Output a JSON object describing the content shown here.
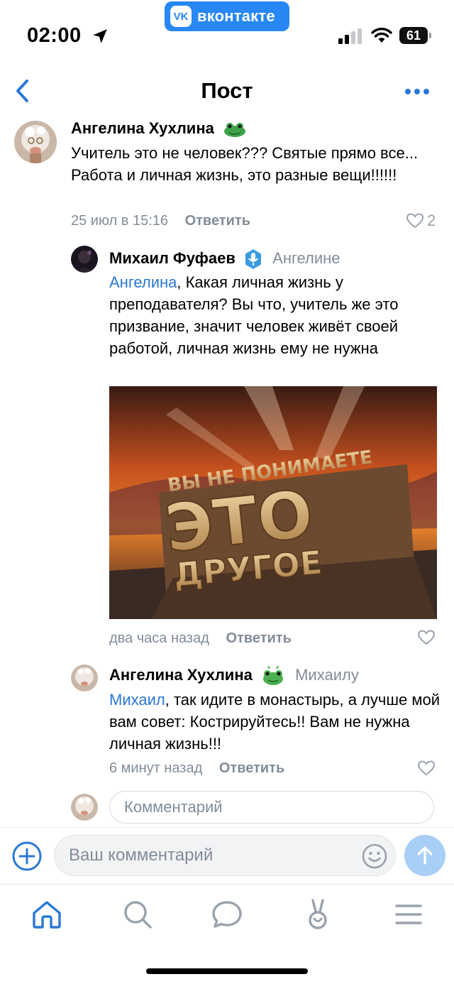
{
  "status_bar": {
    "time": "02:00",
    "app_badge": "вконтакте",
    "app_badge_logo": "VK",
    "battery": "61"
  },
  "nav": {
    "title": "Пост"
  },
  "comments": [
    {
      "author": "Ангелина Хухлина",
      "text": "Учитель это не человек??? Святые прямо все... Работа и личная жизнь, это разные вещи!!!!!!",
      "time": "25 июл в 15:16",
      "reply_label": "Ответить",
      "likes": "2"
    },
    {
      "author": "Михаил Фуфаев",
      "reply_to": "Ангелине",
      "mention": "Ангелина",
      "text": ", Какая личная жизнь у преподавателя? Вы что, учитель же это призвание, значит человек живёт своей работой, личная жизнь ему не нужна",
      "image_text_top": "ВЫ НЕ ПОНИМАЕТЕ",
      "image_text_main": "ЭТО",
      "image_text_bottom": "ДРУГОЕ",
      "time": "два часа назад",
      "reply_label": "Ответить"
    },
    {
      "author": "Ангелина Хухлина",
      "reply_to": "Михаилу",
      "mention": "Михаил",
      "text": ", так идите в монастырь, а лучше мой вам совет: Кострируйтесь!! Вам не нужна личная жизнь!!!",
      "time": "6 минут назад",
      "reply_label": "Ответить"
    }
  ],
  "comment_input": {
    "placeholder": "Комментарий"
  },
  "composer": {
    "placeholder": "Ваш комментарий"
  },
  "tabbar": {
    "icons": [
      "home-icon",
      "search-icon",
      "messages-icon",
      "clips-icon",
      "menu-icon"
    ]
  },
  "colors": {
    "accent": "#2a78d6",
    "vk_blue": "#2787f5",
    "secondary_text": "#818c99",
    "send_button": "#a8cff5"
  }
}
